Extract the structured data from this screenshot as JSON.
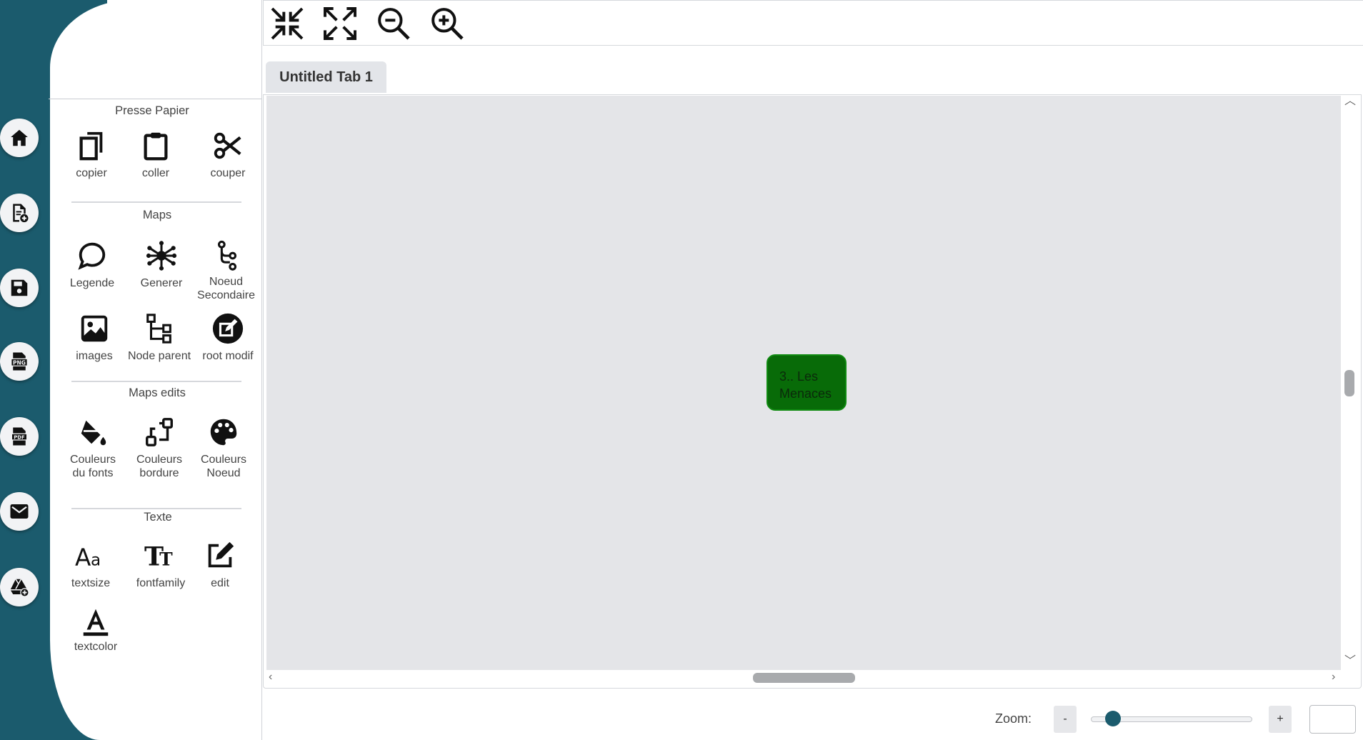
{
  "sidebar": {
    "buttons": [
      {
        "name": "home-icon"
      },
      {
        "name": "new-file-icon"
      },
      {
        "name": "save-icon"
      },
      {
        "name": "export-png-icon"
      },
      {
        "name": "export-pdf-icon"
      },
      {
        "name": "mail-icon"
      },
      {
        "name": "google-drive-add-icon"
      }
    ]
  },
  "tools": {
    "sections": {
      "clipboard": "Presse Papier",
      "maps": "Maps",
      "maps_edits": "Maps edits",
      "text": "Texte"
    },
    "items": {
      "copier": "copier",
      "coller": "coller",
      "couper": "couper",
      "legende": "Legende",
      "generer": "Generer",
      "noeud_secondaire": "Noeud\nSecondaire",
      "images": "images",
      "node_parent": "Node parent",
      "root_modif": "root modif",
      "couleurs_fonts": "Couleurs\ndu fonts",
      "couleurs_bordure": "Couleurs\nbordure",
      "couleurs_noeud": "Couleurs\nNoeud",
      "textsize": "textsize",
      "fontfamily": "fontfamily",
      "edit": "edit",
      "textcolor": "textcolor"
    }
  },
  "toolbar": {
    "buttons": [
      "collapse-icon",
      "expand-icon",
      "zoom-out-icon",
      "zoom-in-icon"
    ]
  },
  "tabs": [
    {
      "label": "Untitled Tab 1",
      "active": true
    }
  ],
  "canvas": {
    "node": {
      "text": "3.. Les Menaces",
      "fill": "#086b08",
      "border": "#0f8a10"
    }
  },
  "zoom": {
    "label": "Zoom:",
    "minus": "-",
    "plus": "+",
    "slider_value": 0.1,
    "input_value": ""
  },
  "colors": {
    "rail": "#1b5b6d",
    "canvas": "#e4e5e8",
    "accent": "#1b5b6d"
  }
}
